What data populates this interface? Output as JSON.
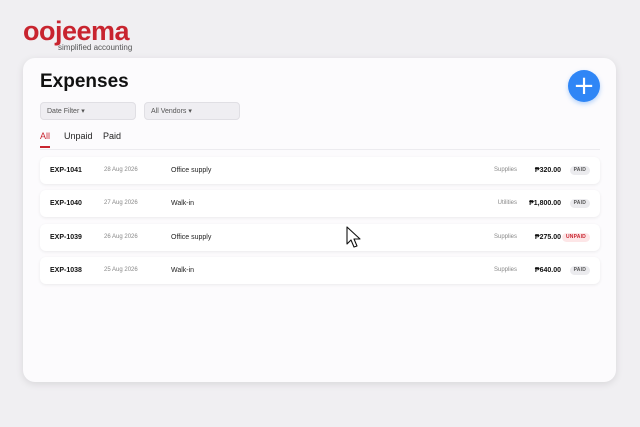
{
  "brand": {
    "name": "oojeema",
    "tagline": "simplified accounting"
  },
  "page": {
    "title": "Expenses",
    "add_label": "+"
  },
  "filters": {
    "date": "Date Filter ▾",
    "vendor": "All Vendors ▾"
  },
  "tabs": [
    {
      "label": "All",
      "active": true
    },
    {
      "label": "Unpaid",
      "active": false
    },
    {
      "label": "Paid",
      "active": false
    }
  ],
  "expenses": [
    {
      "id": "EXP-1041",
      "date": "28 Aug 2026",
      "vendor": "Office supply",
      "category": "Supplies",
      "amount": "₱320.00",
      "status": "PAID"
    },
    {
      "id": "EXP-1040",
      "date": "27 Aug 2026",
      "vendor": "Walk-in",
      "category": "Utilities",
      "amount": "₱1,800.00",
      "status": "PAID"
    },
    {
      "id": "EXP-1039",
      "date": "26 Aug 2026",
      "vendor": "Office supply",
      "category": "Supplies",
      "amount": "₱275.00",
      "status": "UNPAID"
    },
    {
      "id": "EXP-1038",
      "date": "25 Aug 2026",
      "vendor": "Walk-in",
      "category": "Supplies",
      "amount": "₱640.00",
      "status": "PAID"
    }
  ],
  "colors": {
    "brand": "#c8242f",
    "accent": "#2f86f6",
    "paid_bg": "#ebebee",
    "paid_text": "#555555",
    "unpaid_bg": "#fde6e7",
    "unpaid_text": "#c8242f"
  }
}
